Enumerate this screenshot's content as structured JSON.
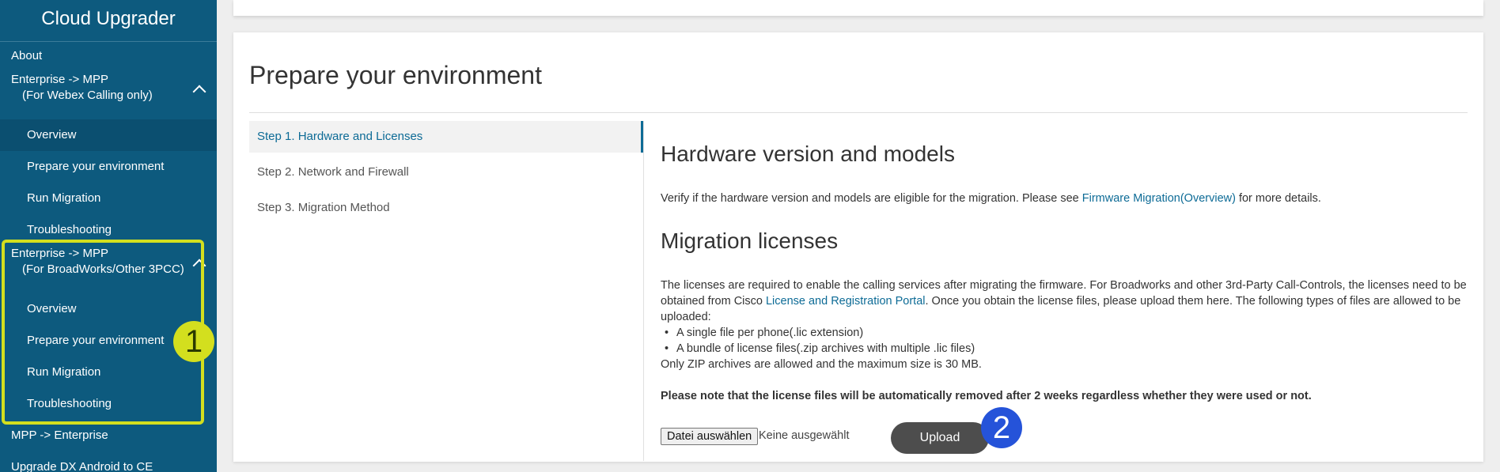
{
  "sidebar": {
    "title": "Cloud Upgrader",
    "about": "About",
    "group1": {
      "line1": "Enterprise -> MPP",
      "line2": "(For Webex Calling only)",
      "items": [
        "Overview",
        "Prepare your environment",
        "Run Migration",
        "Troubleshooting"
      ]
    },
    "group2": {
      "line1": "Enterprise -> MPP",
      "line2": "(For BroadWorks/Other 3PCC)",
      "items": [
        "Overview",
        "Prepare your environment",
        "Run Migration",
        "Troubleshooting"
      ]
    },
    "mpp_enterprise": "MPP -> Enterprise",
    "upgrade_dx": "Upgrade DX Android to CE"
  },
  "markers": {
    "m1": "1",
    "m2": "2"
  },
  "main": {
    "title": "Prepare your environment",
    "steps": [
      "Step 1. Hardware and Licenses",
      "Step 2. Network and Firewall",
      "Step 3. Migration Method"
    ],
    "hardware": {
      "heading": "Hardware version and models",
      "text_before": "Verify if the hardware version and models are eligible for the migration. Please see ",
      "link": "Firmware Migration(Overview)",
      "text_after": " for more details."
    },
    "licenses": {
      "heading": "Migration licenses",
      "text_before": "The licenses are required to enable the calling services after migrating the firmware. For Broadworks and other 3rd-Party Call-Controls, the licenses need to be obtained from Cisco ",
      "link": "License and Registration Portal",
      "text_after": ". Once you obtain the license files, please upload them here. The following types of files are allowed to be uploaded:",
      "bullets": [
        "A single file per phone(.lic extension)",
        "A bundle of license files(.zip archives with multiple .lic files)"
      ],
      "limit": "Only ZIP archives are allowed and the maximum size is 30 MB.",
      "note": "Please note that the license files will be automatically removed after 2 weeks regardless whether they were used or not."
    },
    "file_button": "Datei auswählen",
    "file_status": "Keine ausgewählt",
    "upload": "Upload"
  }
}
